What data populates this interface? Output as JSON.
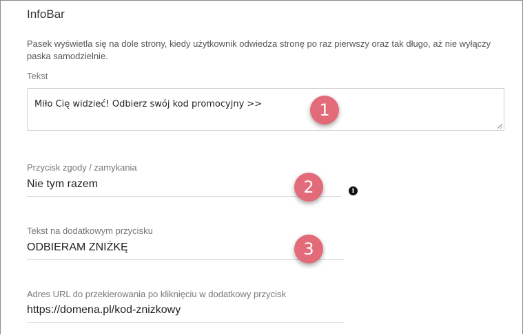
{
  "section": {
    "title": "InfoBar",
    "description": "Pasek wyświetla się na dole strony, kiedy użytkownik odwiedza stronę po raz pierwszy oraz tak długo, aż nie wyłączy paska samodzielnie."
  },
  "fields": {
    "text": {
      "label": "Tekst",
      "value": "Miło Cię widzieć! Odbierz swój kod promocyjny >>"
    },
    "close_button": {
      "label": "Przycisk zgody / zamykania",
      "value": "Nie tym razem"
    },
    "extra_button": {
      "label": "Tekst na dodatkowym przycisku",
      "value": "ODBIERAM ZNIŻKĘ"
    },
    "redirect_url": {
      "label": "Adres URL do przekierowania po kliknięciu w dodatkowy przycisk",
      "value": "https://domena.pl/kod-znizkowy"
    }
  },
  "badges": [
    "1",
    "2",
    "3"
  ],
  "icons": {
    "info": "info-icon",
    "info_glyph": "i"
  },
  "colors": {
    "badge": "#e36a78"
  }
}
